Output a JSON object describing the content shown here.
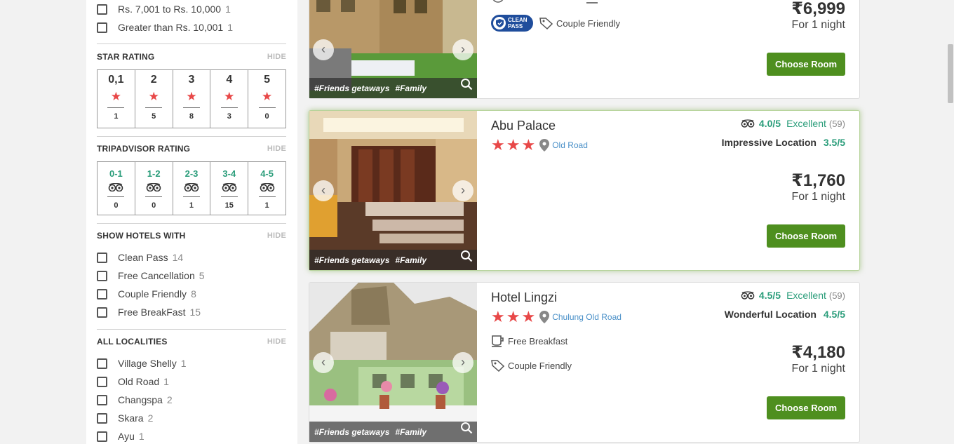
{
  "price_filters": [
    {
      "label": "Rs. 7,001 to Rs. 10,000",
      "count": "1"
    },
    {
      "label": "Greater than Rs. 10,001",
      "count": "1"
    }
  ],
  "star_rating": {
    "title": "STAR RATING",
    "hide": "HIDE",
    "cells": [
      {
        "label": "0,1",
        "count": "1"
      },
      {
        "label": "2",
        "count": "5"
      },
      {
        "label": "3",
        "count": "8"
      },
      {
        "label": "4",
        "count": "3"
      },
      {
        "label": "5",
        "count": "0"
      }
    ]
  },
  "tripadvisor_rating": {
    "title": "TRIPADVISOR RATING",
    "hide": "HIDE",
    "cells": [
      {
        "label": "0-1",
        "count": "0"
      },
      {
        "label": "1-2",
        "count": "0"
      },
      {
        "label": "2-3",
        "count": "1"
      },
      {
        "label": "3-4",
        "count": "15"
      },
      {
        "label": "4-5",
        "count": "1"
      }
    ]
  },
  "show_hotels_with": {
    "title": "SHOW HOTELS WITH",
    "hide": "HIDE",
    "items": [
      {
        "label": "Clean Pass",
        "count": "14"
      },
      {
        "label": "Free Cancellation",
        "count": "5"
      },
      {
        "label": "Couple Friendly",
        "count": "8"
      },
      {
        "label": "Free BreakFast",
        "count": "15"
      }
    ]
  },
  "localities": {
    "title": "ALL LOCALITIES",
    "hide": "HIDE",
    "items": [
      {
        "label": "Village Shelly",
        "count": "1"
      },
      {
        "label": "Old Road",
        "count": "1"
      },
      {
        "label": "Changspa",
        "count": "2"
      },
      {
        "label": "Skara",
        "count": "2"
      },
      {
        "label": "Ayu",
        "count": "1"
      }
    ]
  },
  "hotels": [
    {
      "clean_pass": "CLEAN PASS",
      "amenity": "Couple Friendly",
      "tags": [
        "#Friends getaways",
        "#Family"
      ],
      "price": "₹6,999",
      "per": "For 1 night",
      "cta": "Choose Room"
    },
    {
      "name": "Abu Palace",
      "stars": 3,
      "location": "Old Road",
      "ta_score": "4.0/5",
      "ta_label": "Excellent",
      "ta_reviews": "(59)",
      "loc_label": "Impressive Location",
      "loc_score": "3.5/5",
      "tags": [
        "#Friends getaways",
        "#Family"
      ],
      "price": "₹1,760",
      "per": "For 1 night",
      "cta": "Choose Room"
    },
    {
      "name": "Hotel Lingzi",
      "stars": 3,
      "location": "Chulung Old Road",
      "ta_score": "4.5/5",
      "ta_label": "Excellent",
      "ta_reviews": "(59)",
      "loc_label": "Wonderful Location",
      "loc_score": "4.5/5",
      "amenities": [
        "Free Breakfast",
        "Couple Friendly"
      ],
      "tags": [
        "#Friends getaways",
        "#Family"
      ],
      "price": "₹4,180",
      "per": "For 1 night",
      "cta": "Choose Room"
    }
  ],
  "colors": {
    "accent_green": "#4e8f1f",
    "rating_teal": "#2a9d7a",
    "star_red": "#e84848",
    "link_blue": "#4a90c8"
  },
  "icons": [
    "checkbox-icon",
    "star-icon",
    "tripadvisor-owl-icon",
    "location-pin-icon",
    "tag-icon",
    "coffee-cup-icon",
    "magnifier-icon",
    "chevron-left-icon",
    "chevron-right-icon",
    "shield-icon"
  ]
}
